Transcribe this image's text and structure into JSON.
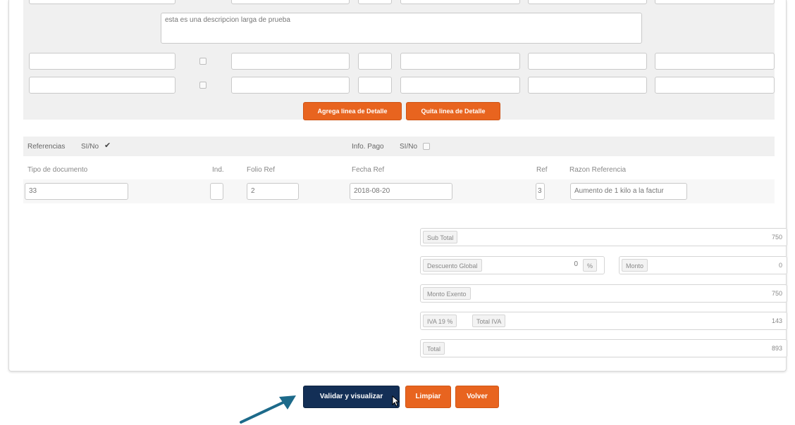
{
  "detalle": {
    "descripcion": "esta es una descripcion larga de prueba",
    "add_button": "Agrega linea de Detalle",
    "remove_button": "Quita linea de Detalle"
  },
  "referencias": {
    "label": "Referencias",
    "sino": "SI/No",
    "checked": true,
    "columns": {
      "tipo": "Tipo de documento",
      "ind": "Ind.",
      "folio": "Folio Ref",
      "fecha": "Fecha Ref",
      "ref": "Ref",
      "razon": "Razon Referencia"
    },
    "row": {
      "tipo": "33",
      "ind": "",
      "folio": "2",
      "fecha": "2018-08-20",
      "ref": "3",
      "razon": "Aumento de 1 kilo a la factur"
    }
  },
  "info_pago": {
    "label": "Info. Pago",
    "sino": "SI/No",
    "checked": false
  },
  "totales": {
    "subtotal_label": "Sub Total",
    "subtotal_value": "750",
    "descuento_label": "Descuento Global",
    "descuento_value": "0",
    "percent_label": "%",
    "monto_label": "Monto",
    "monto_value": "0",
    "exento_label": "Monto Exento",
    "exento_value": "750",
    "iva_label": "IVA 19 %",
    "total_iva_label": "Total IVA",
    "total_iva_value": "143",
    "total_label": "Total",
    "total_value": "893"
  },
  "actions": {
    "validar": "Validar y visualizar",
    "limpiar": "Limpiar",
    "volver": "Volver"
  },
  "colors": {
    "accent_orange": "#e8641f",
    "primary_navy": "#132f56",
    "arrow": "#1d6a8a"
  }
}
